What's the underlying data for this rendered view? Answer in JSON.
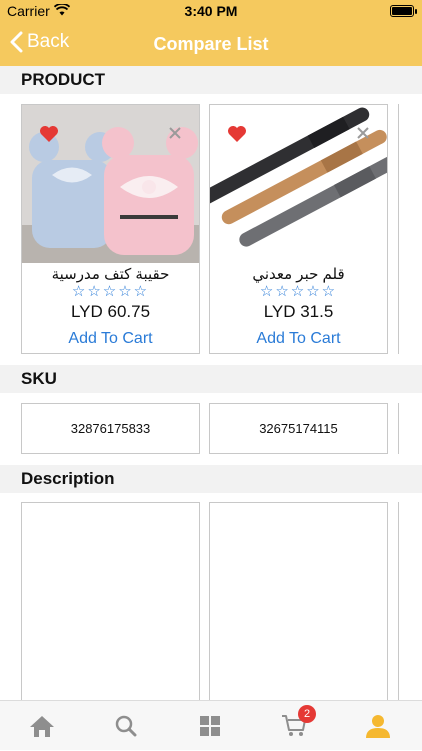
{
  "status_bar": {
    "carrier": "Carrier",
    "time": "3:40 PM"
  },
  "nav": {
    "back_label": "Back",
    "title": "Compare List"
  },
  "sections": {
    "product": "PRODUCT",
    "sku": "SKU",
    "description": "Description"
  },
  "products": [
    {
      "name": "حقيبة كتف مدرسية",
      "stars": "☆☆☆☆☆",
      "price": "LYD 60.75",
      "add_to_cart": "Add To Cart",
      "sku": "32876175833",
      "image": "backpack-image"
    },
    {
      "name": "قلم حبر معدني",
      "stars": "☆☆☆☆☆",
      "price": "LYD 31.5",
      "add_to_cart": "Add To Cart",
      "sku": "32675174115",
      "image": "pen-image"
    }
  ],
  "tab_bar": {
    "cart_badge": "2",
    "items": [
      "home-icon",
      "search-icon",
      "categories-icon",
      "cart-icon",
      "profile-icon"
    ]
  },
  "colors": {
    "accent": "#f5c95e",
    "link": "#2a7bd7",
    "badge": "#e53935"
  }
}
